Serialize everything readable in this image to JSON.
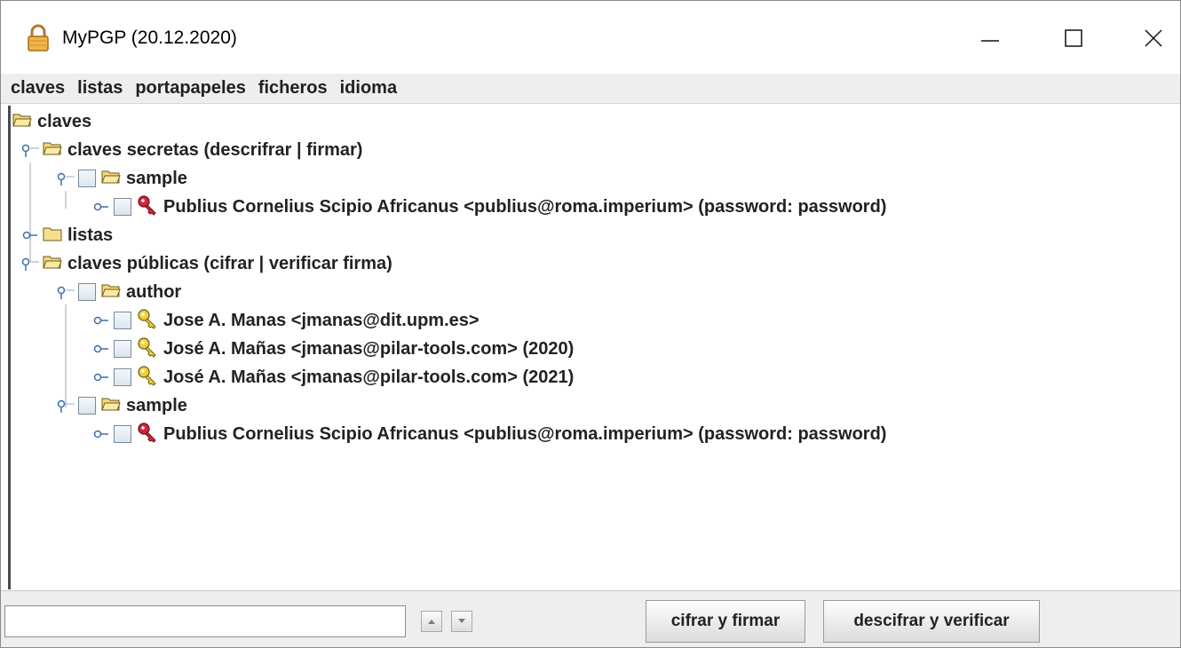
{
  "window": {
    "title": "MyPGP (20.12.2020)",
    "icon": "lock-icon"
  },
  "menu": [
    {
      "label": "claves"
    },
    {
      "label": "listas"
    },
    {
      "label": "portapapeles"
    },
    {
      "label": "ficheros"
    },
    {
      "label": "idioma"
    }
  ],
  "tree": {
    "root": "claves",
    "secret_folder": "claves secretas (descrifrar | firmar)",
    "secret_sample": "sample",
    "secret_key_1": "Publius Cornelius Scipio Africanus <publius@roma.imperium> (password: password)",
    "lists_folder": "listas",
    "public_folder": "claves públicas (cifrar | verificar firma)",
    "public_author": "author",
    "public_key_1": "Jose A. Manas <jmanas@dit.upm.es>",
    "public_key_2": "José A. Mañas <jmanas@pilar-tools.com> (2020)",
    "public_key_3": "José A. Mañas <jmanas@pilar-tools.com> (2021)",
    "public_sample": "sample",
    "public_key_4": "Publius Cornelius Scipio Africanus <publius@roma.imperium> (password: password)"
  },
  "bottom": {
    "search_value": "",
    "encrypt_sign_label": "cifrar y firmar",
    "decrypt_verify_label": "descifrar y verificar"
  },
  "colors": {
    "secret_key": "#c8102e",
    "public_key": "#e0c21a",
    "folder": "#f3d77a"
  }
}
